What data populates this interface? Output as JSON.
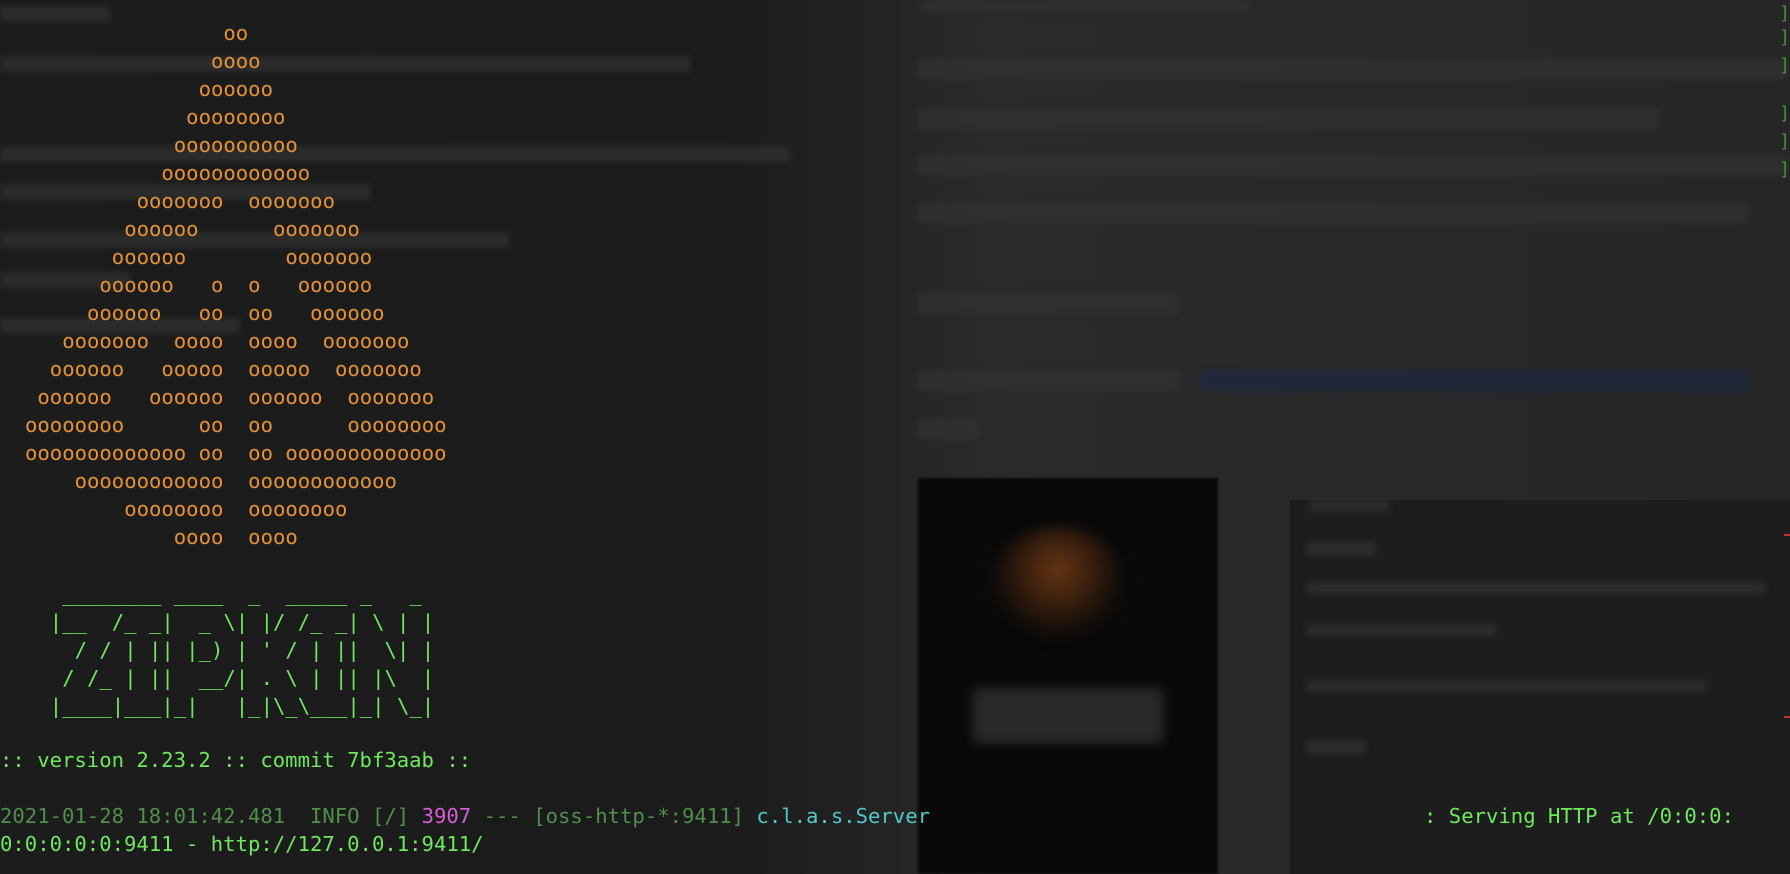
{
  "ascii_art": {
    "logo": "                oo\n               oooo\n              oooooo\n             oooooooo\n            oooooooooo\n           oooooooooooo\n         ooooooo  ooooooo\n        oooooo      ooooooo\n       oooooo        ooooooo\n      oooooo   o  o   oooooo\n     oooooo   oo  oo   oooooo\n   ooooooo  oooo  oooo  ooooooo\n  oooooo   ooooo  ooooo  ooooooo\n oooooo   oooooo  oooooo  ooooooo\noooooooo      oo  oo      oooooooo\nooooooooooooo oo  oo ooooooooooooo\n    oooooooooooo  oooooooooooo\n        oooooooo  oooooooo\n            oooo  oooo",
    "wordmark": "   ________ ____  _  _____ _   _\n  |__  /_ _|  _ \\| |/ /_ _| \\ | |\n    / / | || |_) | ' / | ||  \\| |\n   / /_ | ||  __/| . \\ | || |\\  |\n  |____|___|_|   |_|\\_\\___|_| \\_|"
  },
  "version_line": ":: version 2.23.2 :: commit 7bf3aab ::",
  "log": {
    "date": "2021-01-28 18:01:42.481",
    "level": "INFO",
    "context": "[/]",
    "pid": "3907",
    "separator": "---",
    "thread": "[oss-http-*:9411]",
    "logger": "c.l.a.s.Server",
    "message_head": ": Serving HTTP at /0:0:0:",
    "message_tail": "0:0:0:0:0:9411 - http://127.0.0.1:9411/"
  },
  "colors": {
    "background": "#161616",
    "logo_orange": "#e5913a",
    "text_green": "#6ee85e",
    "dim_green": "#4f8f4a",
    "pid_magenta": "#d65ed8",
    "logger_cyan": "#53c6c9"
  }
}
